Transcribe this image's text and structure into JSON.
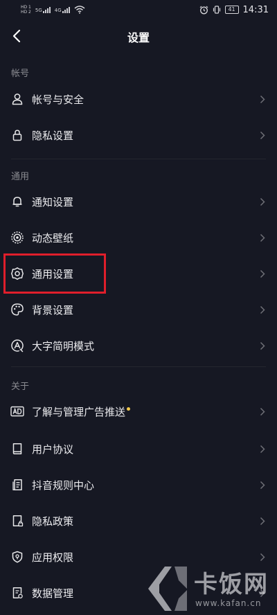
{
  "status_bar": {
    "hd1": "HD 1",
    "hd2": "HD 2",
    "net1": "5G",
    "net2": "4G",
    "battery": "41",
    "time": "14:31"
  },
  "header": {
    "back_icon": "chevron-left-icon",
    "title": "设置"
  },
  "sections": [
    {
      "title": "帐号",
      "items": [
        {
          "icon": "user-icon",
          "label": "帐号与安全"
        },
        {
          "icon": "lock-icon",
          "label": "隐私设置"
        }
      ]
    },
    {
      "title": "通用",
      "items": [
        {
          "icon": "bell-icon",
          "label": "通知设置"
        },
        {
          "icon": "live-wallpaper-icon",
          "label": "动态壁纸"
        },
        {
          "icon": "gear-icon",
          "label": "通用设置"
        },
        {
          "icon": "palette-icon",
          "label": "背景设置"
        },
        {
          "icon": "font-size-icon",
          "label": "大字简明模式"
        }
      ]
    },
    {
      "title": "关于",
      "items": [
        {
          "icon": "ad-icon",
          "label": "了解与管理广告推送",
          "badge": "dot"
        },
        {
          "icon": "book-icon",
          "label": "用户协议"
        },
        {
          "icon": "document-icon",
          "label": "抖音规则中心"
        },
        {
          "icon": "privacy-doc-icon",
          "label": "隐私政策"
        },
        {
          "icon": "shield-icon",
          "label": "应用权限"
        },
        {
          "icon": "data-icon",
          "label": "数据管理"
        }
      ]
    }
  ],
  "watermark": {
    "brand": "卡饭网",
    "url": "www.kafan.cn"
  },
  "colors": {
    "background": "#161823",
    "highlight": "#e01e2b",
    "badge": "#f2c94c"
  }
}
